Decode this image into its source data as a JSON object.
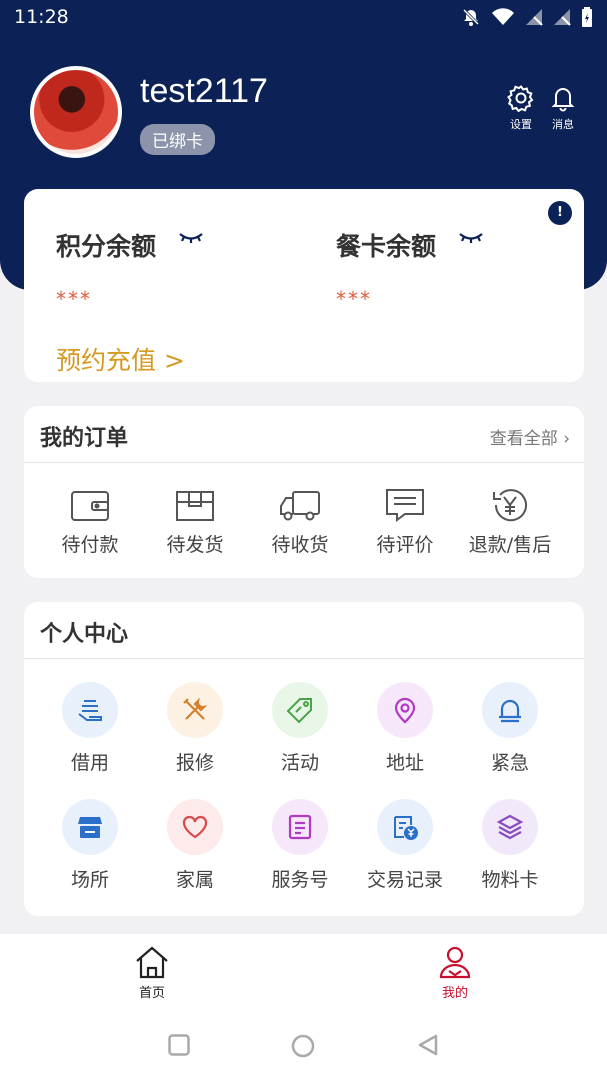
{
  "status_bar": {
    "time": "11:28",
    "icons": [
      "bell-off-icon",
      "wifi-icon",
      "signal-off-icon",
      "signal-off-icon",
      "battery-icon"
    ]
  },
  "profile": {
    "username": "test2117",
    "card_status": "已绑卡"
  },
  "header_actions": [
    {
      "icon": "gear-icon",
      "label": "设置"
    },
    {
      "icon": "bell-icon",
      "label": "消息"
    }
  ],
  "balance": {
    "points_label": "积分余额",
    "points_value": "***",
    "meal_card_label": "餐卡余额",
    "meal_card_value": "***",
    "info_icon": "!",
    "recharge_label": "预约充值",
    "recharge_chevron": ">"
  },
  "orders": {
    "title": "我的订单",
    "view_all": "查看全部",
    "items": [
      {
        "icon": "wallet-icon",
        "label": "待付款"
      },
      {
        "icon": "package-icon",
        "label": "待发货"
      },
      {
        "icon": "truck-icon",
        "label": "待收货"
      },
      {
        "icon": "comment-icon",
        "label": "待评价"
      },
      {
        "icon": "refund-yen-icon",
        "label": "退款/售后"
      }
    ]
  },
  "personal_center": {
    "title": "个人中心",
    "items": [
      {
        "icon": "borrow-icon",
        "label": "借用",
        "color": "#2a6fc9",
        "bg": "#e8f1fb"
      },
      {
        "icon": "repair-tools-icon",
        "label": "报修",
        "color": "#d4802a",
        "bg": "#fdf1e4"
      },
      {
        "icon": "tag-icon",
        "label": "活动",
        "color": "#4aa34a",
        "bg": "#e8f6e8"
      },
      {
        "icon": "location-pin-icon",
        "label": "地址",
        "color": "#b03ac2",
        "bg": "#f7e7fa"
      },
      {
        "icon": "alarm-icon",
        "label": "紧急",
        "color": "#2a6fc9",
        "bg": "#e8f1fb"
      },
      {
        "icon": "store-icon",
        "label": "场所",
        "color": "#2a6fc9",
        "bg": "#e8f1fb"
      },
      {
        "icon": "heart-icon",
        "label": "家属",
        "color": "#d94a4a",
        "bg": "#fdeaea"
      },
      {
        "icon": "service-doc-icon",
        "label": "服务号",
        "color": "#b03ac2",
        "bg": "#f7e7fa"
      },
      {
        "icon": "transaction-record-icon",
        "label": "交易记录",
        "color": "#2a6fc9",
        "bg": "#e8f1fb"
      },
      {
        "icon": "layers-icon",
        "label": "物料卡",
        "color": "#8a4ac2",
        "bg": "#f1e9fa"
      }
    ]
  },
  "bottom_nav": [
    {
      "icon": "home-icon",
      "label": "首页",
      "active": false
    },
    {
      "icon": "user-icon",
      "label": "我的",
      "active": true
    }
  ],
  "colors": {
    "header_bg": "#0c2155",
    "accent_gold": "#d69a23",
    "value_red": "#e05a3a",
    "nav_active": "#c8102e"
  }
}
